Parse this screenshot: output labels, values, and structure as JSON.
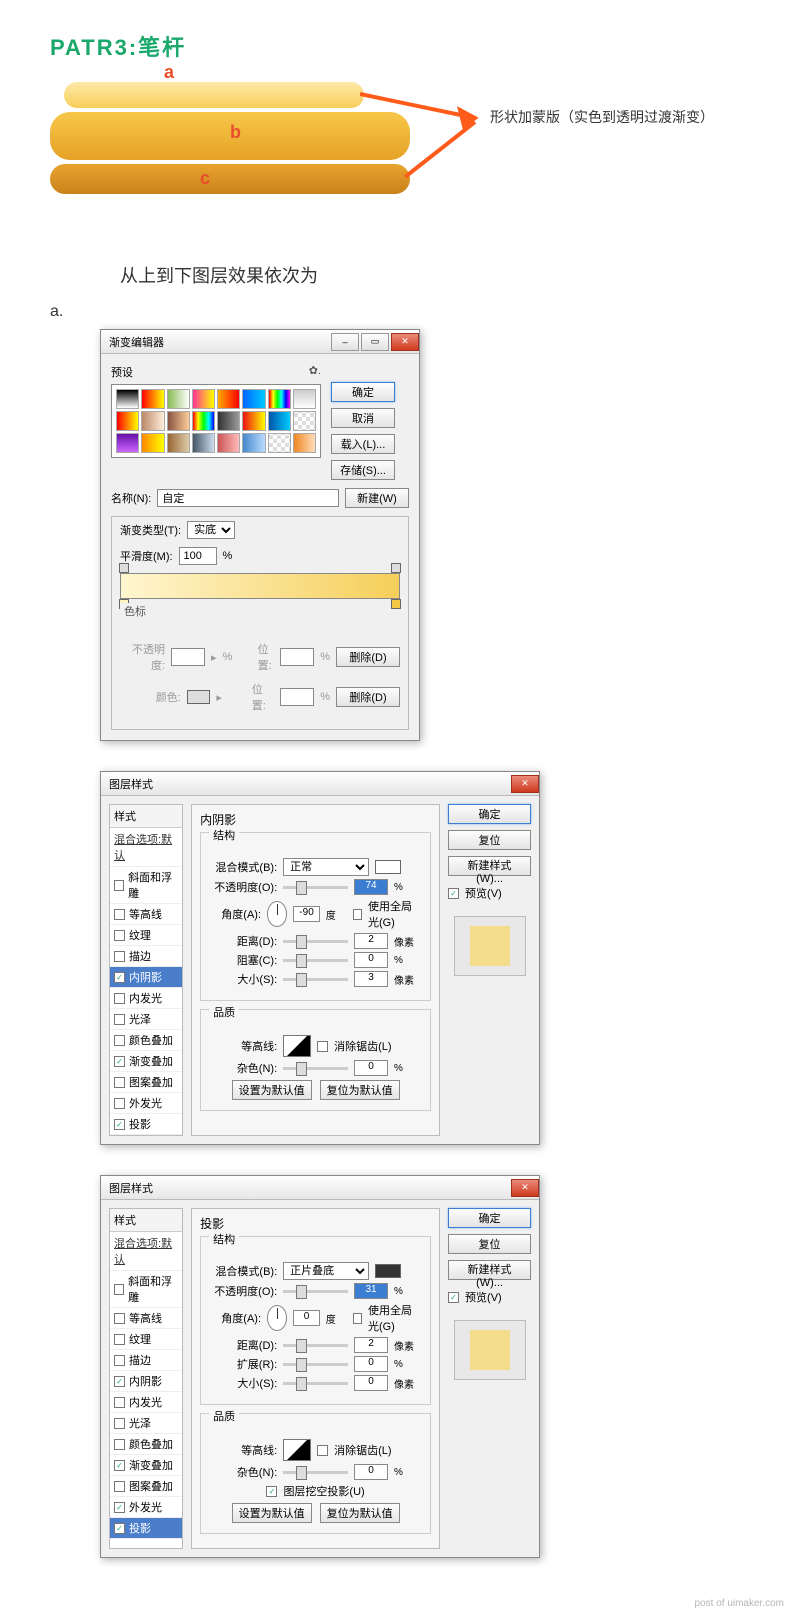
{
  "title": "PATR3:笔杆",
  "diagram": {
    "a": "a",
    "b": "b",
    "c": "c",
    "caption": "形状加蒙版（实色到透明过渡渐变）"
  },
  "subheading": "从上到下图层效果依次为",
  "sectionA": "a.",
  "ge": {
    "title": "渐变编辑器",
    "presets": "预设",
    "ok": "确定",
    "cancel": "取消",
    "load": "载入(L)...",
    "save": "存储(S)...",
    "nameLabel": "名称(N):",
    "nameValue": "自定",
    "new": "新建(W)",
    "typeLabel": "渐变类型(T):",
    "typeValue": "实底",
    "smoothLabel": "平滑度(M):",
    "smoothValue": "100",
    "pct": "%",
    "stops": "色标",
    "opLabel": "不透明度:",
    "posLabel": "位置:",
    "delete": "删除(D)",
    "colorLabel": "颜色:"
  },
  "lsCommon": {
    "title": "图层样式",
    "stylesHead": "样式",
    "blendDefault": "混合选项:默认",
    "items": [
      "斜面和浮雕",
      "等高线",
      "纹理",
      "描边",
      "内阴影",
      "内发光",
      "光泽",
      "颜色叠加",
      "渐变叠加",
      "图案叠加",
      "外发光",
      "投影"
    ],
    "ok": "确定",
    "reset": "复位",
    "newStyle": "新建样式(W)...",
    "preview": "预览(V)",
    "structure": "结构",
    "quality": "品质",
    "blendModeLabel": "混合模式(B):",
    "opacityLabel": "不透明度(O):",
    "angleLabel": "角度(A):",
    "deg": "度",
    "globalLight": "使用全局光(G)",
    "distanceLabel": "距离(D):",
    "px": "像素",
    "pct": "%",
    "sizeLabel": "大小(S):",
    "contourLabel": "等高线:",
    "antialias": "消除锯齿(L)",
    "noiseLabel": "杂色(N):",
    "setDefault": "设置为默认值",
    "resetDefault": "复位为默认值"
  },
  "ls1": {
    "panelTitle": "内阴影",
    "blendMode": "正常",
    "opacity": "74",
    "angle": "-90",
    "distance": "2",
    "choke": "0",
    "chokeLabel": "阻塞(C):",
    "size": "3",
    "checked": [
      "内阴影",
      "渐变叠加",
      "投影"
    ]
  },
  "ls2": {
    "panelTitle": "投影",
    "blendMode": "正片叠底",
    "opacity": "31",
    "angle": "0",
    "distance": "2",
    "spread": "0",
    "spreadLabel": "扩展(R):",
    "size": "0",
    "knockout": "图层挖空投影(U)",
    "checked": [
      "内阴影",
      "渐变叠加",
      "外发光",
      "投影"
    ]
  },
  "footer": "post of uimaker.com"
}
